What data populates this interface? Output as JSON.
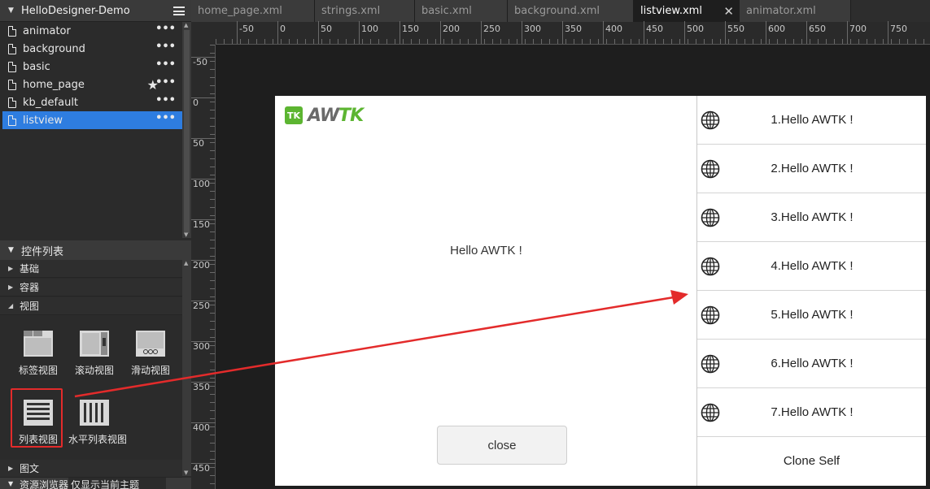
{
  "project": {
    "title": "HelloDesigner-Demo"
  },
  "files": [
    {
      "label": "animator",
      "more": "•••"
    },
    {
      "label": "background",
      "more": "•••"
    },
    {
      "label": "basic",
      "more": "•••"
    },
    {
      "label": "home_page",
      "more": "•••"
    },
    {
      "label": "kb_default",
      "more": "•••"
    },
    {
      "label": "listview",
      "more": "•••"
    }
  ],
  "controls": {
    "title": "控件列表",
    "categories": [
      "基础",
      "容器",
      "视图",
      "图文"
    ],
    "widgets": [
      "标签视图",
      "滚动视图",
      "滑动视图",
      "列表视图",
      "水平列表视图"
    ]
  },
  "resources": {
    "title": "资源浏览器",
    "filter": "仅显示当前主题"
  },
  "tabs": [
    {
      "label": "home_page.xml"
    },
    {
      "label": "strings.xml"
    },
    {
      "label": "basic.xml"
    },
    {
      "label": "background.xml"
    },
    {
      "label": "listview.xml",
      "close": "✕"
    },
    {
      "label": "animator.xml"
    }
  ],
  "ruler": {
    "top": [
      "-50",
      "0",
      "50",
      "100",
      "150",
      "200",
      "250",
      "300",
      "350",
      "400",
      "450",
      "500",
      "550",
      "600",
      "650",
      "700",
      "750"
    ],
    "left": [
      "-50",
      "0",
      "50",
      "100",
      "150",
      "200",
      "250",
      "300",
      "350",
      "400",
      "450"
    ]
  },
  "preview": {
    "logo_badge": "TK",
    "logo_text_a": "AW",
    "logo_text_b": "TK",
    "hello": "Hello AWTK !",
    "close": "close",
    "list_items": [
      "1.Hello AWTK !",
      "2.Hello AWTK !",
      "3.Hello AWTK !",
      "4.Hello AWTK !",
      "5.Hello AWTK !",
      "6.Hello AWTK !",
      "7.Hello AWTK !"
    ],
    "clone": "Clone Self"
  },
  "colors": {
    "accent": "#2e7de0",
    "highlight": "#e32b2b",
    "brand": "#5cb531"
  }
}
